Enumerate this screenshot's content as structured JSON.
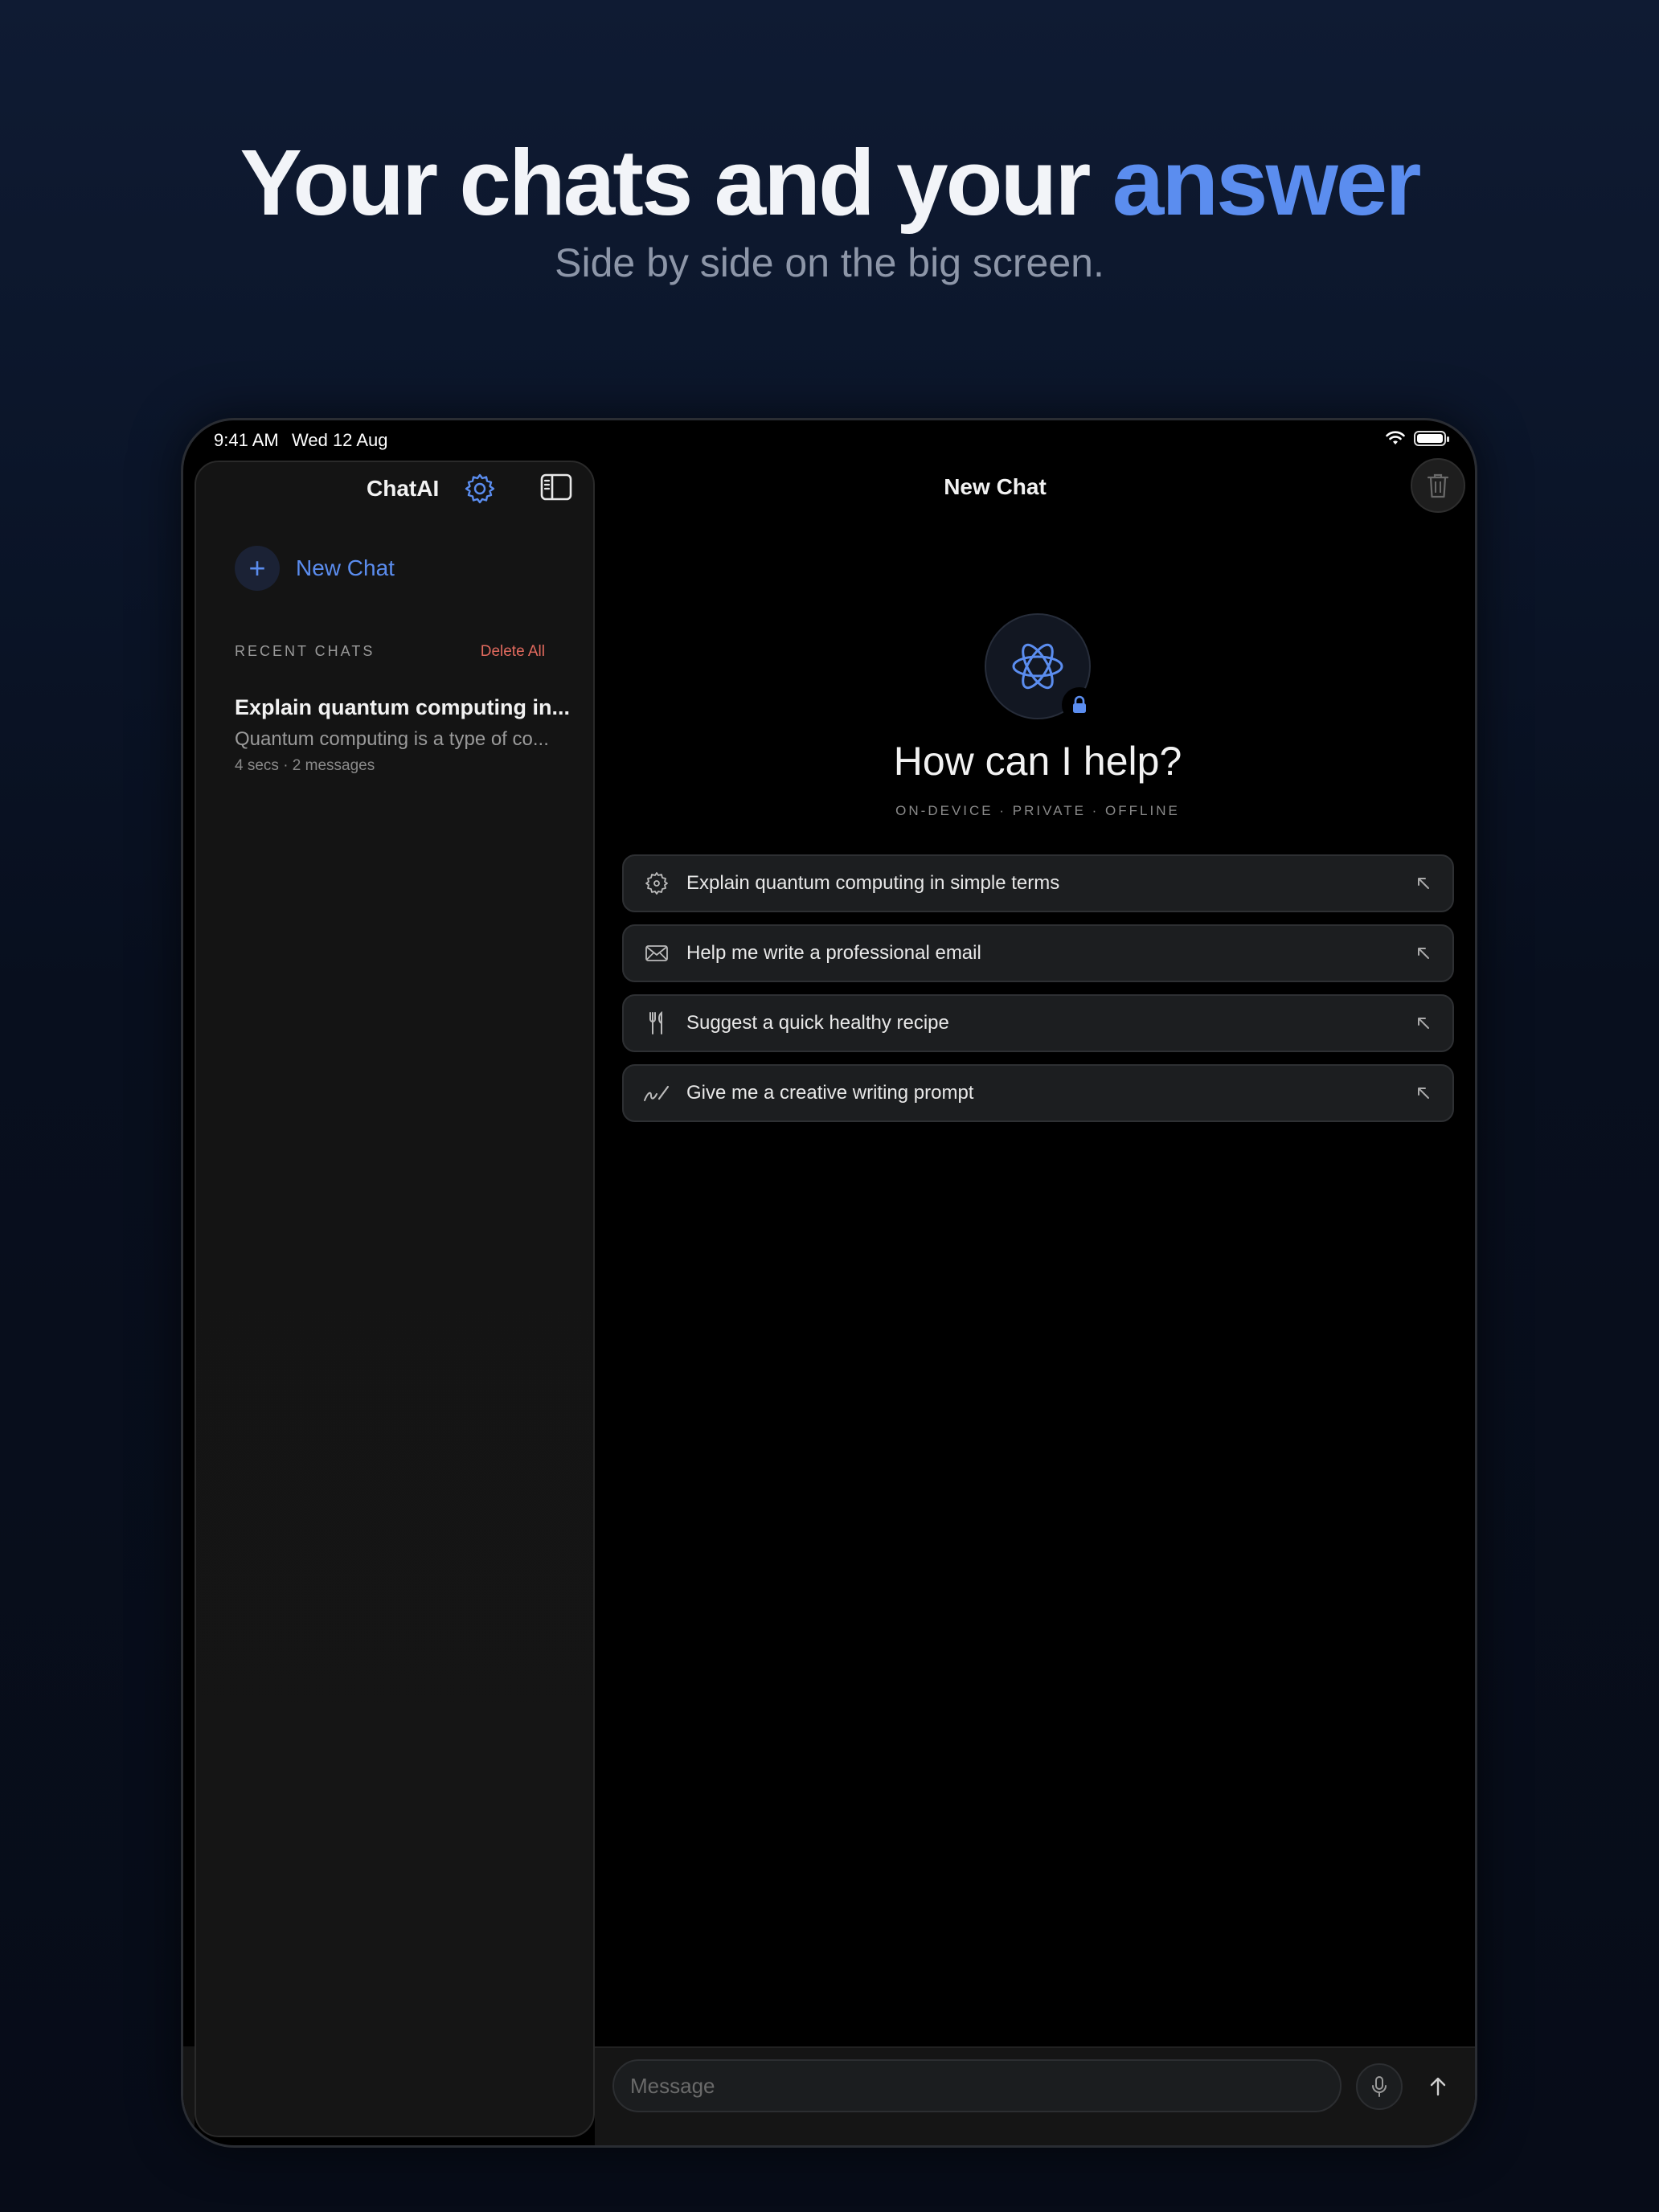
{
  "hero": {
    "headline_prefix": "Your chats and your ",
    "headline_accent": "answer",
    "subheadline": "Side by side on the big screen."
  },
  "statusbar": {
    "time": "9:41 AM",
    "date": "Wed 12 Aug",
    "icons": [
      "wifi-icon",
      "battery-icon"
    ],
    "battery_level": 1.0
  },
  "sidebar": {
    "title": "ChatAI",
    "new_chat_label": "New Chat",
    "section_label": "RECENT CHATS",
    "delete_all_label": "Delete All",
    "chats": [
      {
        "title": "Explain quantum computing in...",
        "preview": "Quantum computing is a type of co...",
        "meta": "4 secs · 2 messages"
      }
    ]
  },
  "main": {
    "title": "New Chat",
    "greeting": "How can I help?",
    "tagline": "ON-DEVICE · PRIVATE · OFFLINE",
    "suggestions": [
      {
        "icon": "atom-icon",
        "label": "Explain quantum computing in simple terms"
      },
      {
        "icon": "envelope-icon",
        "label": "Help me write a professional email"
      },
      {
        "icon": "fork-knife-icon",
        "label": "Suggest a quick healthy recipe"
      },
      {
        "icon": "signature-pen-icon",
        "label": "Give me a creative writing prompt"
      }
    ]
  },
  "composer": {
    "placeholder": "Message",
    "value": ""
  },
  "colors": {
    "accent": "#5b8def",
    "destructive": "#e26a5e",
    "background": "#000000"
  }
}
